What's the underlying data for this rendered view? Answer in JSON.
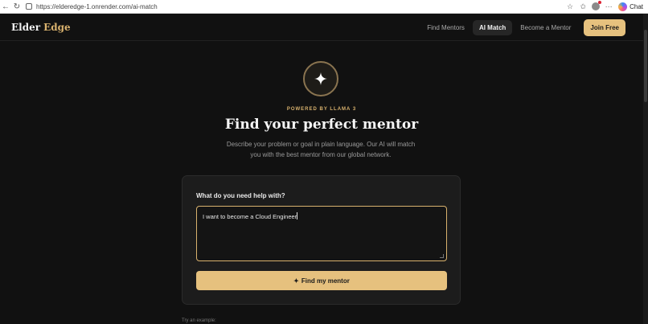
{
  "browser": {
    "url": "https://elderedge-1.onrender.com/ai-match",
    "chat_label": "Chat"
  },
  "site": {
    "logo_primary": "Elder",
    "logo_accent": "Edge",
    "nav": {
      "find_mentors": "Find Mentors",
      "ai_match": "AI Match",
      "become_mentor": "Become a Mentor",
      "join_free": "Join Free"
    }
  },
  "hero": {
    "powered_by": "POWERED BY LLAMA 3",
    "title": "Find your perfect mentor",
    "subtitle": "Describe your problem or goal in plain language. Our AI will match you with the best mentor from our global network."
  },
  "form": {
    "label": "What do you need help with?",
    "input_value": "I want to become a Cloud Engineer",
    "submit_label": "Find my mentor",
    "submit_icon": "✦"
  },
  "examples": {
    "label": "Try an example:"
  },
  "colors": {
    "accent": "#e6c17e",
    "background": "#111111"
  }
}
